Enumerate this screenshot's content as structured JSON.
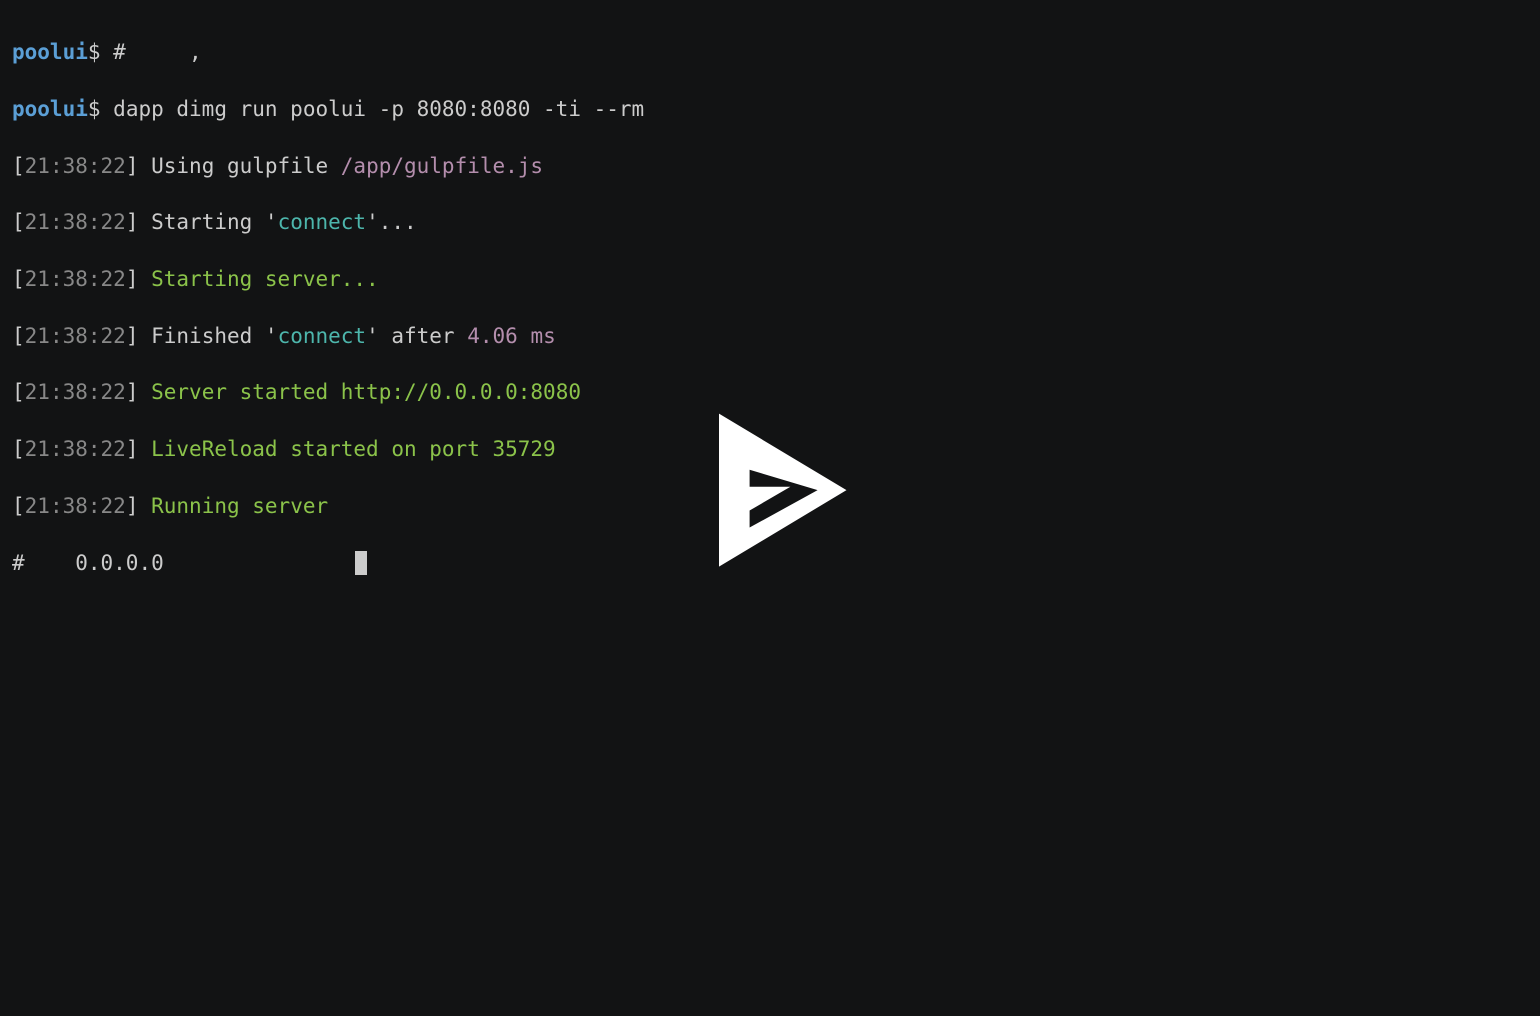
{
  "prompt": {
    "host": "poolui",
    "dollar": "$"
  },
  "commands": {
    "line1": "#     ,",
    "line2": "dapp dimg run poolui -p 8080:8080 -ti --rm"
  },
  "timestamp": "21:38:22",
  "log": {
    "line1_prefix": "Using gulpfile ",
    "line1_path": "/app/gulpfile.js",
    "line2_prefix": "Starting '",
    "line2_task": "connect",
    "line2_suffix": "'...",
    "line3": "Starting server...",
    "line4_prefix": "Finished '",
    "line4_task": "connect",
    "line4_mid": "' after ",
    "line4_time": "4.06 ms",
    "line5": "Server started http://0.0.0.0:8080",
    "line6": "LiveReload started on port 35729",
    "line7": "Running server"
  },
  "bottom": {
    "hash": "#",
    "ip": "0.0.0.0"
  }
}
